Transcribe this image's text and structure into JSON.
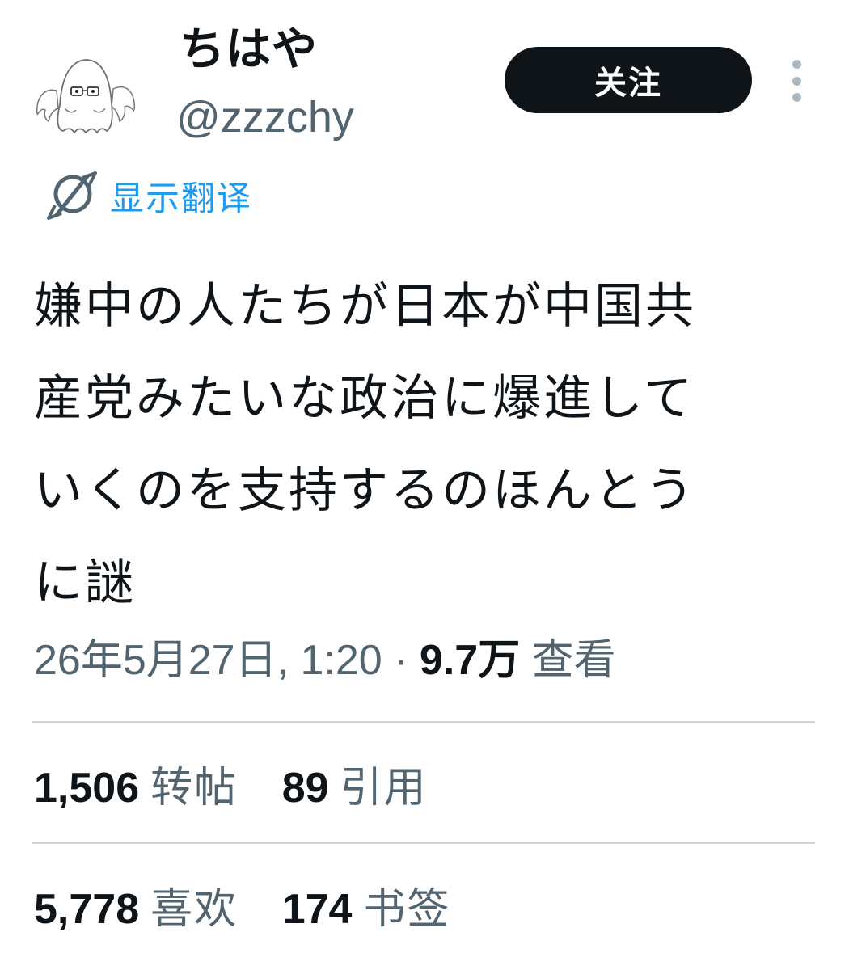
{
  "user": {
    "display_name": "ちはや",
    "handle": "@zzzchy",
    "avatar_icon": "ghost-with-glasses-avatar"
  },
  "actions": {
    "follow_label": "关注",
    "more_icon": "vertical-ellipsis-icon"
  },
  "translate": {
    "label": "显示翻译",
    "icon": "globe-translate-icon"
  },
  "tweet": {
    "lines": [
      "嫌中の人たちが日本が中国共",
      "産党みたいな政治に爆進して",
      "いくのを支持するのほんとう",
      "に謎"
    ]
  },
  "meta": {
    "timestamp": "26年5月27日, 1:20",
    "separator": " · ",
    "views_count": "9.7万",
    "views_label": "查看"
  },
  "stats": {
    "reposts": {
      "count": "1,506",
      "label": "转帖"
    },
    "quotes": {
      "count": "89",
      "label": "引用"
    },
    "likes": {
      "count": "5,778",
      "label": "喜欢"
    },
    "bookmarks": {
      "count": "174",
      "label": "书签"
    }
  },
  "colors": {
    "text_primary": "#0f1419",
    "text_secondary": "#536471",
    "link_blue": "#1d9bf0",
    "follow_button_bg": "#0f1419",
    "divider": "#cfd9de"
  }
}
